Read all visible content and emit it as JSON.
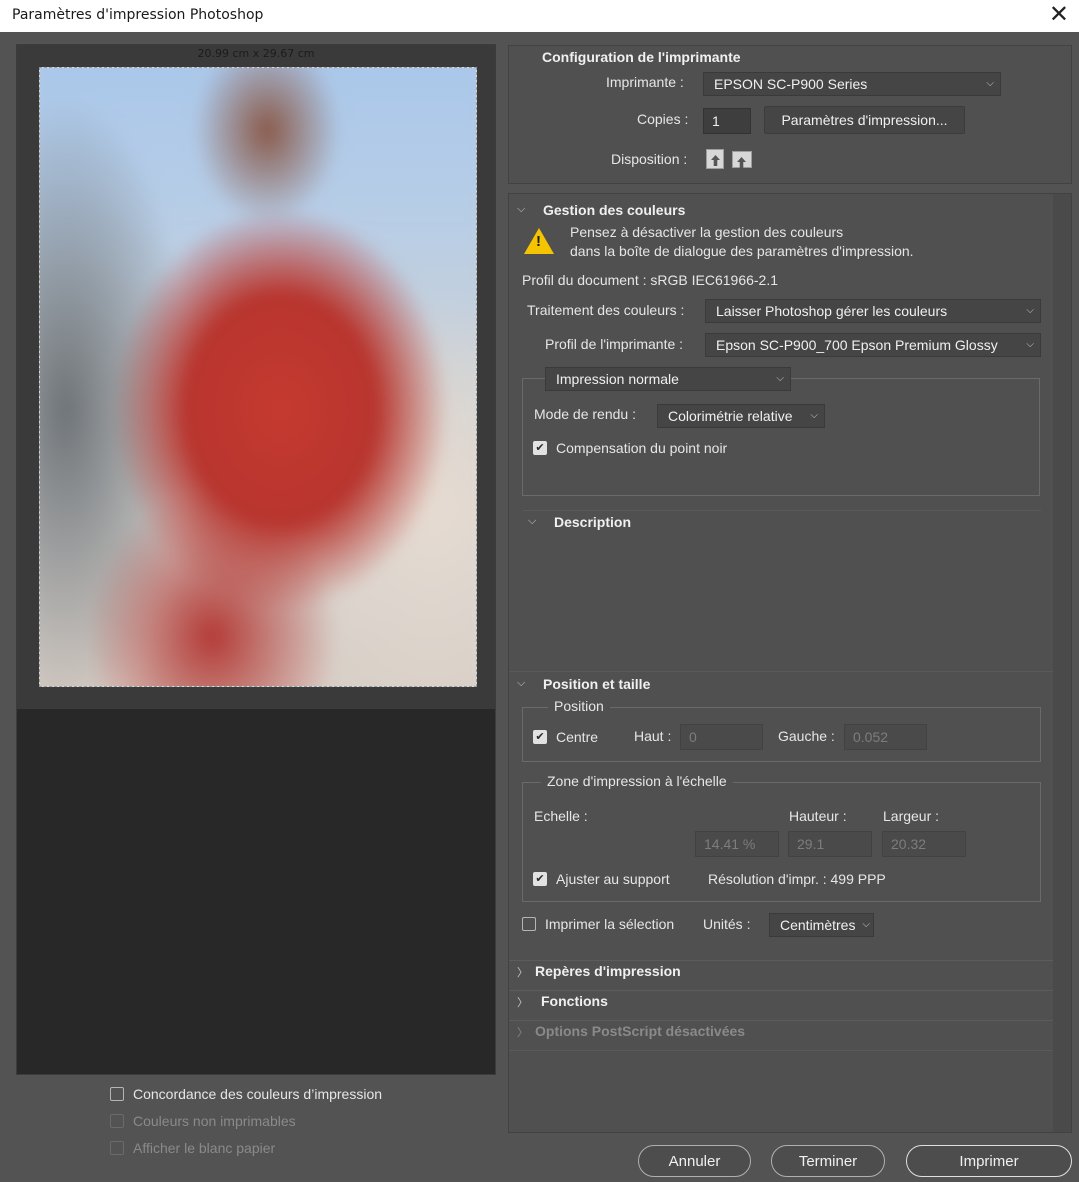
{
  "window": {
    "title": "Paramètres d'impression Photoshop",
    "close": "✕"
  },
  "preview": {
    "dimensions": "20.99 cm x 29.67 cm"
  },
  "left_checks": {
    "concordance": "Concordance des couleurs d’impression",
    "non_imprimables": "Couleurs non imprimables",
    "blanc_papier": "Afficher le blanc papier"
  },
  "printer": {
    "title": "Configuration de l'imprimante",
    "printer_label": "Imprimante :",
    "printer_value": "EPSON SC-P900 Series",
    "copies_label": "Copies :",
    "copies_value": "1",
    "print_settings_button": "Paramètres d'impression...",
    "layout_label": "Disposition :"
  },
  "color": {
    "title": "Gestion des couleurs",
    "warning_line1": "Pensez à désactiver la gestion des couleurs",
    "warning_line2": "dans la boîte de dialogue des paramètres d'impression.",
    "doc_profile": "Profil du document : sRGB IEC61966-2.1",
    "handling_label": "Traitement des couleurs :",
    "handling_value": "Laisser Photoshop gérer les couleurs",
    "printer_profile_label": "Profil de l'imprimante :",
    "printer_profile_value": "Epson SC-P900_700 Epson Premium Glossy",
    "print_mode": "Impression normale",
    "rendering_label": "Mode de rendu :",
    "rendering_value": "Colorimétrie relative",
    "black_point": "Compensation du point noir"
  },
  "description": {
    "title": "Description"
  },
  "position": {
    "title": "Position et taille",
    "position_legend": "Position",
    "center": "Centre",
    "top_label": "Haut :",
    "top_value": "0",
    "left_label": "Gauche :",
    "left_value": "0.052",
    "scale_legend": "Zone d'impression à l'échelle",
    "scale_label": "Echelle :",
    "height_label": "Hauteur :",
    "width_label": "Largeur :",
    "scale_value": "14.41 %",
    "height_value": "29.1",
    "width_value": "20.32",
    "fit_media": "Ajuster au support",
    "resolution": "Résolution d'impr. : 499 PPP",
    "print_selection": "Imprimer la sélection",
    "units_label": "Unités :",
    "units_value": "Centimètres"
  },
  "sections": {
    "marks": "Repères d'impression",
    "functions": "Fonctions",
    "postscript": "Options PostScript désactivées"
  },
  "buttons": {
    "cancel": "Annuler",
    "done": "Terminer",
    "print": "Imprimer"
  }
}
